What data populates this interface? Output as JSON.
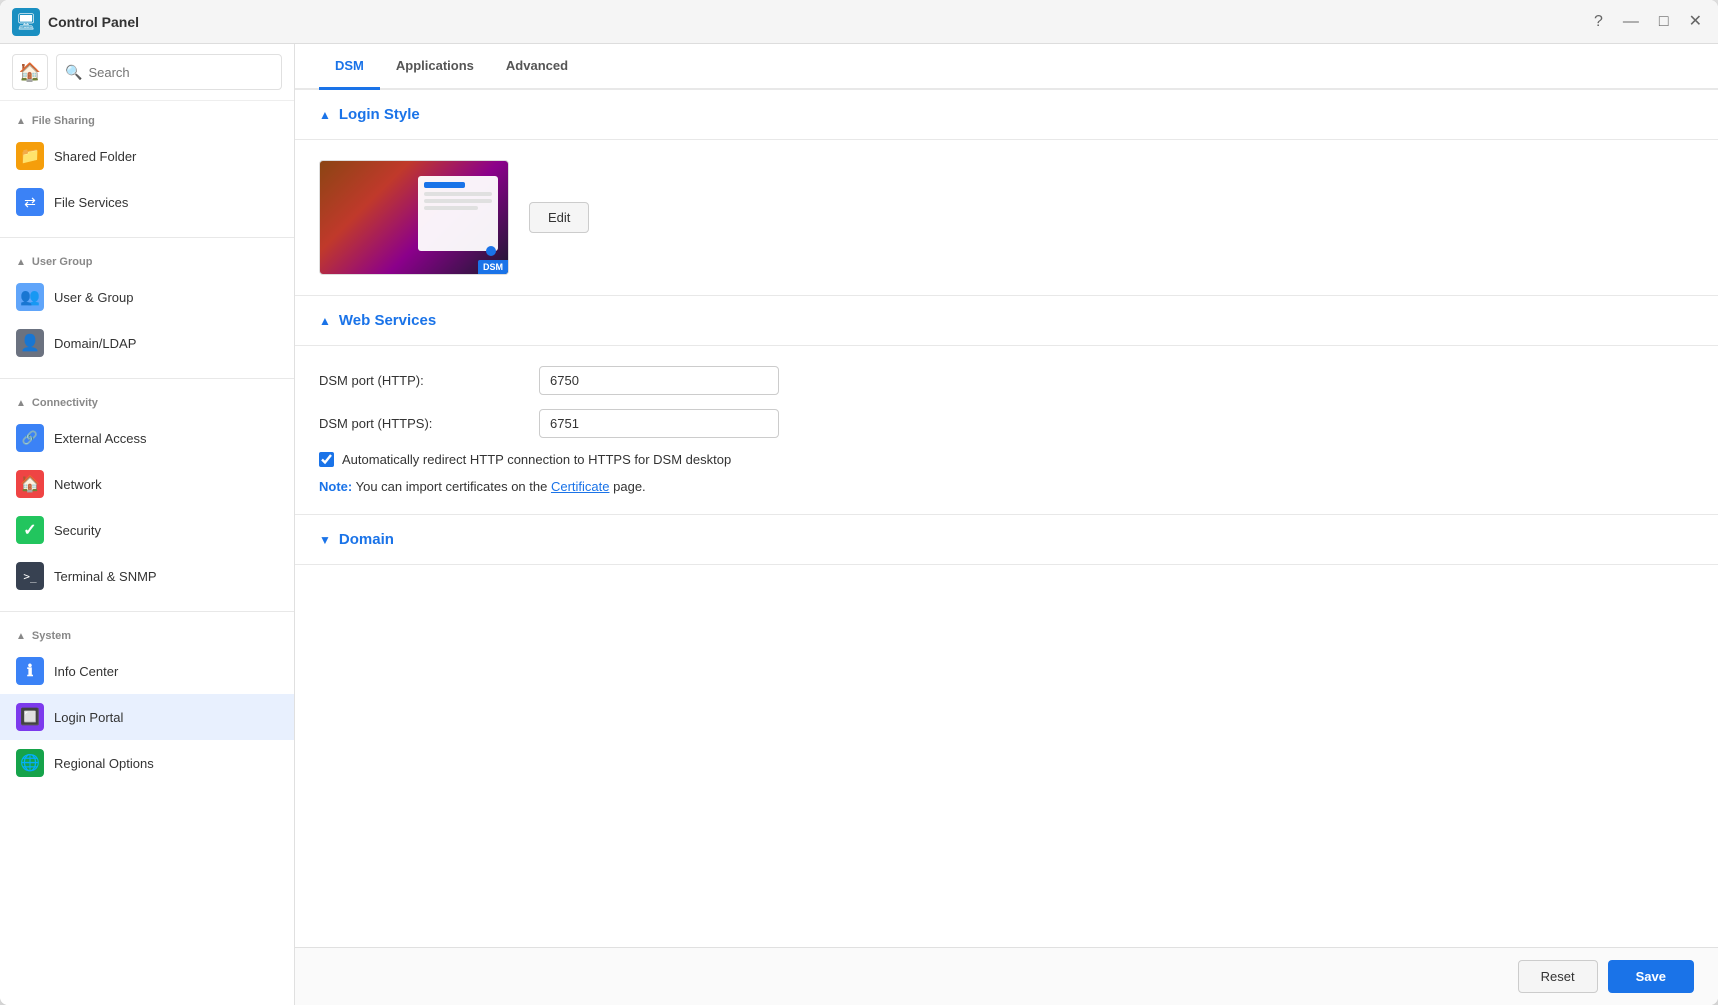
{
  "window": {
    "title": "Control Panel",
    "icon": "🖥️"
  },
  "titlebar": {
    "controls": {
      "help": "?",
      "minimize": "—",
      "maximize": "□",
      "close": "✕"
    }
  },
  "sidebar": {
    "search_placeholder": "Search",
    "sections": [
      {
        "id": "file-sharing",
        "label": "File Sharing",
        "collapsed": false,
        "items": [
          {
            "id": "shared-folder",
            "label": "Shared Folder",
            "icon_class": "icon-shared-folder",
            "icon": "📁"
          },
          {
            "id": "file-services",
            "label": "File Services",
            "icon_class": "icon-file-services",
            "icon": "⇄"
          }
        ]
      },
      {
        "id": "user-group",
        "label": "User Group",
        "collapsed": false,
        "items": [
          {
            "id": "user-group",
            "label": "User & Group",
            "icon_class": "icon-user-group",
            "icon": "👥"
          },
          {
            "id": "domain-ldap",
            "label": "Domain/LDAP",
            "icon_class": "icon-domain-ldap",
            "icon": "👤"
          }
        ]
      },
      {
        "id": "connectivity",
        "label": "Connectivity",
        "collapsed": false,
        "items": [
          {
            "id": "external-access",
            "label": "External Access",
            "icon_class": "icon-external-access",
            "icon": "🔗"
          },
          {
            "id": "network",
            "label": "Network",
            "icon_class": "icon-network",
            "icon": "🏠"
          },
          {
            "id": "security",
            "label": "Security",
            "icon_class": "icon-security",
            "icon": "✓"
          },
          {
            "id": "terminal-snmp",
            "label": "Terminal & SNMP",
            "icon_class": "icon-terminal",
            "icon": ">_"
          }
        ]
      },
      {
        "id": "system",
        "label": "System",
        "collapsed": false,
        "items": [
          {
            "id": "info-center",
            "label": "Info Center",
            "icon_class": "icon-info-center",
            "icon": "ℹ"
          },
          {
            "id": "login-portal",
            "label": "Login Portal",
            "icon_class": "icon-login-portal",
            "icon": "🔲",
            "active": true
          },
          {
            "id": "regional-options",
            "label": "Regional Options",
            "icon_class": "icon-regional",
            "icon": "🌐"
          }
        ]
      }
    ]
  },
  "tabs": {
    "items": [
      {
        "id": "dsm",
        "label": "DSM",
        "active": true
      },
      {
        "id": "applications",
        "label": "Applications",
        "active": false
      },
      {
        "id": "advanced",
        "label": "Advanced",
        "active": false
      }
    ]
  },
  "content": {
    "login_style_section": {
      "title": "Login Style",
      "expanded": true,
      "chevron_expanded": "▲",
      "edit_button_label": "Edit"
    },
    "web_services_section": {
      "title": "Web Services",
      "expanded": true,
      "chevron_expanded": "▲",
      "dsm_port_http_label": "DSM port (HTTP):",
      "dsm_port_http_value": "6750",
      "dsm_port_https_label": "DSM port (HTTPS):",
      "dsm_port_https_value": "6751",
      "redirect_label": "Automatically redirect HTTP connection to HTTPS for DSM desktop",
      "redirect_checked": true,
      "note_label": "Note:",
      "note_text": " You can import certificates on the ",
      "note_link": "Certificate",
      "note_suffix": " page."
    },
    "domain_section": {
      "title": "Domain",
      "expanded": false,
      "chevron_collapsed": "▼"
    }
  },
  "footer": {
    "reset_label": "Reset",
    "save_label": "Save"
  }
}
